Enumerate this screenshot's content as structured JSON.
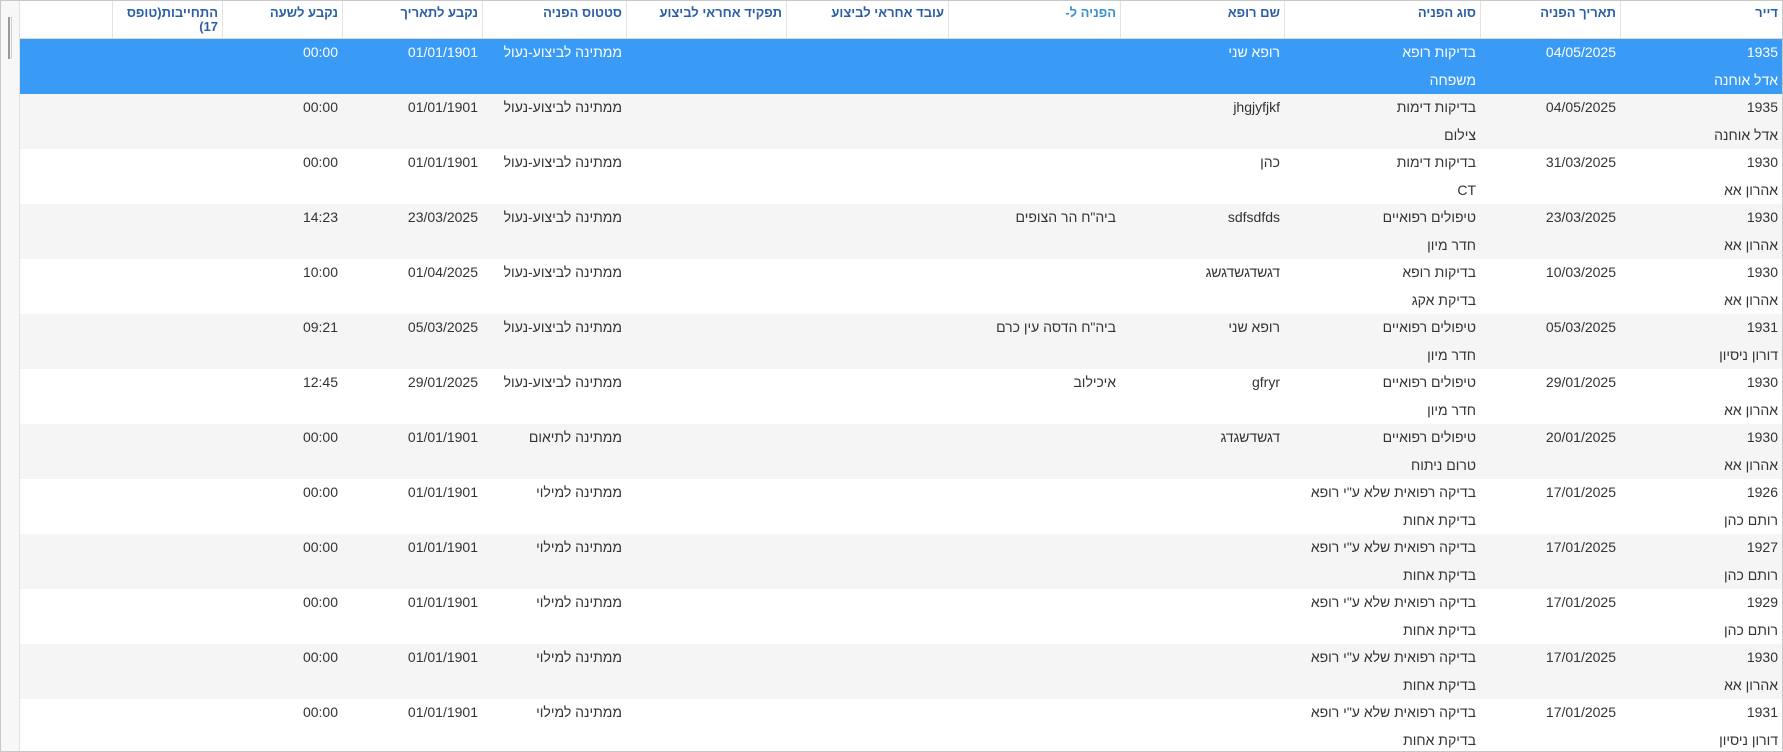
{
  "columns": {
    "dayar": "דייר",
    "request_date": "תאריך הפניה",
    "request_type": "סוג הפניה",
    "doctor_name": "שם רופא",
    "refer_to": "הפניה ל-",
    "worker": "עובד אחראי לביצוע",
    "role": "תפקיד אחראי לביצוע",
    "status": "סטטוס הפניה",
    "fixed_date": "נקבע לתאריך",
    "fixed_time": "נקבע לשעה",
    "commitment": "התחייבות(טופס 17)"
  },
  "rows": [
    {
      "id": "1935",
      "name": "אדל אוחנה",
      "date": "04/05/2025",
      "type": "בדיקות רופא",
      "subtype": "משפחה",
      "doctor": "רופא שני",
      "refer_to": "",
      "worker": "",
      "role": "",
      "status": "ממתינה לביצוע-נעול",
      "fixed_date": "01/01/1901",
      "fixed_time": "00:00",
      "commitment": ""
    },
    {
      "id": "1935",
      "name": "אדל אוחנה",
      "date": "04/05/2025",
      "type": "בדיקות דימות",
      "subtype": "צילום",
      "doctor": "jhgjyfjkf",
      "refer_to": "",
      "worker": "",
      "role": "",
      "status": "ממתינה לביצוע-נעול",
      "fixed_date": "01/01/1901",
      "fixed_time": "00:00",
      "commitment": ""
    },
    {
      "id": "1930",
      "name": "אהרון אא",
      "date": "31/03/2025",
      "type": "בדיקות דימות",
      "subtype": "CT",
      "doctor": "כהן",
      "refer_to": "",
      "worker": "",
      "role": "",
      "status": "ממתינה לביצוע-נעול",
      "fixed_date": "01/01/1901",
      "fixed_time": "00:00",
      "commitment": ""
    },
    {
      "id": "1930",
      "name": "אהרון אא",
      "date": "23/03/2025",
      "type": "טיפולים רפואיים",
      "subtype": "חדר מיון",
      "doctor": "sdfsdfds",
      "refer_to": "ביה\"ח הר הצופים",
      "worker": "",
      "role": "",
      "status": "ממתינה לביצוע-נעול",
      "fixed_date": "23/03/2025",
      "fixed_time": "14:23",
      "commitment": ""
    },
    {
      "id": "1930",
      "name": "אהרון אא",
      "date": "10/03/2025",
      "type": "בדיקות רופא",
      "subtype": "בדיקת אקג",
      "doctor": "דגשדגשדגשג",
      "refer_to": "",
      "worker": "",
      "role": "",
      "status": "ממתינה לביצוע-נעול",
      "fixed_date": "01/04/2025",
      "fixed_time": "10:00",
      "commitment": ""
    },
    {
      "id": "1931",
      "name": "דורון ניסיון",
      "date": "05/03/2025",
      "type": "טיפולים רפואיים",
      "subtype": "חדר מיון",
      "doctor": "רופא שני",
      "refer_to": "ביה\"ח הדסה עין כרם",
      "worker": "",
      "role": "",
      "status": "ממתינה לביצוע-נעול",
      "fixed_date": "05/03/2025",
      "fixed_time": "09:21",
      "commitment": ""
    },
    {
      "id": "1930",
      "name": "אהרון אא",
      "date": "29/01/2025",
      "type": "טיפולים רפואיים",
      "subtype": "חדר מיון",
      "doctor": "gfryr",
      "refer_to": "איכילוב",
      "worker": "",
      "role": "",
      "status": "ממתינה לביצוע-נעול",
      "fixed_date": "29/01/2025",
      "fixed_time": "12:45",
      "commitment": ""
    },
    {
      "id": "1930",
      "name": "אהרון אא",
      "date": "20/01/2025",
      "type": "טיפולים רפואיים",
      "subtype": "טרום ניתוח",
      "doctor": "דגשדשגדג",
      "refer_to": "",
      "worker": "",
      "role": "",
      "status": "ממתינה לתיאום",
      "fixed_date": "01/01/1901",
      "fixed_time": "00:00",
      "commitment": ""
    },
    {
      "id": "1926",
      "name": "רותם כהן",
      "date": "17/01/2025",
      "type": "בדיקה רפואית שלא ע\"י רופא",
      "subtype": "בדיקת אחות",
      "doctor": "",
      "refer_to": "",
      "worker": "",
      "role": "",
      "status": "ממתינה למילוי",
      "fixed_date": "01/01/1901",
      "fixed_time": "00:00",
      "commitment": ""
    },
    {
      "id": "1927",
      "name": "רותם כהן",
      "date": "17/01/2025",
      "type": "בדיקה רפואית שלא ע\"י רופא",
      "subtype": "בדיקת אחות",
      "doctor": "",
      "refer_to": "",
      "worker": "",
      "role": "",
      "status": "ממתינה למילוי",
      "fixed_date": "01/01/1901",
      "fixed_time": "00:00",
      "commitment": ""
    },
    {
      "id": "1929",
      "name": "רותם כהן",
      "date": "17/01/2025",
      "type": "בדיקה רפואית שלא ע\"י רופא",
      "subtype": "בדיקת אחות",
      "doctor": "",
      "refer_to": "",
      "worker": "",
      "role": "",
      "status": "ממתינה למילוי",
      "fixed_date": "01/01/1901",
      "fixed_time": "00:00",
      "commitment": ""
    },
    {
      "id": "1930",
      "name": "אהרון אא",
      "date": "17/01/2025",
      "type": "בדיקה רפואית שלא ע\"י רופא",
      "subtype": "בדיקת אחות",
      "doctor": "",
      "refer_to": "",
      "worker": "",
      "role": "",
      "status": "ממתינה למילוי",
      "fixed_date": "01/01/1901",
      "fixed_time": "00:00",
      "commitment": ""
    },
    {
      "id": "1931",
      "name": "דורון ניסיון",
      "date": "17/01/2025",
      "type": "בדיקה רפואית שלא ע\"י רופא",
      "subtype": "בדיקת אחות",
      "doctor": "",
      "refer_to": "",
      "worker": "",
      "role": "",
      "status": "ממתינה למילוי",
      "fixed_date": "01/01/1901",
      "fixed_time": "00:00",
      "commitment": ""
    }
  ],
  "selected_row": 0
}
